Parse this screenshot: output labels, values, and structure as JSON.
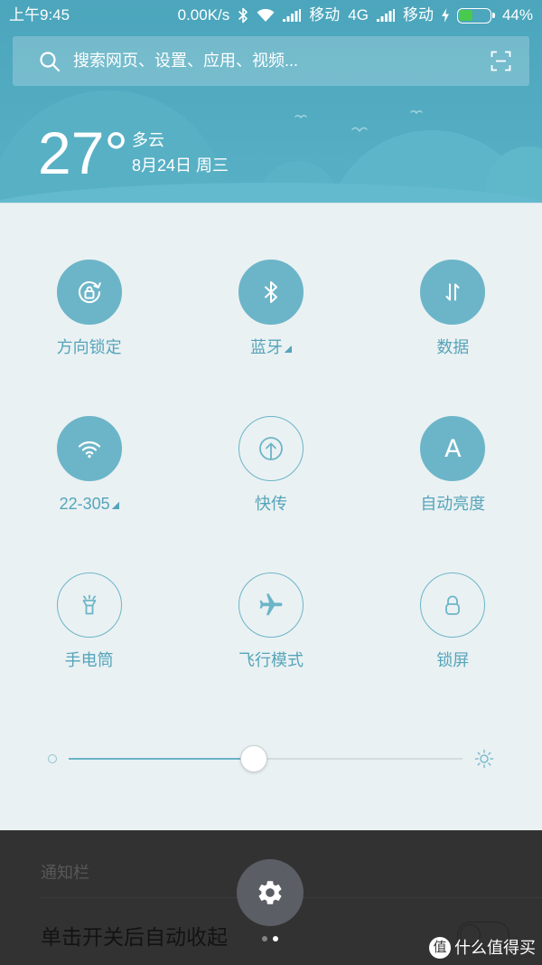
{
  "status_bar": {
    "time": "上午9:45",
    "net_speed": "0.00K/s",
    "carrier_1": "移动",
    "network_type": "4G",
    "carrier_2": "移动",
    "battery": "44%",
    "battery_color": "#49c94d",
    "icons": [
      "bluetooth-icon",
      "wifi-icon",
      "signal-icon",
      "charging-icon",
      "battery-icon"
    ]
  },
  "search": {
    "placeholder": "搜索网页、设置、应用、视频...",
    "icons": [
      "search-icon",
      "scan-icon"
    ]
  },
  "weather": {
    "temperature": "27°",
    "condition": "多云",
    "date": "8月24日 周三"
  },
  "quick_toggles": [
    {
      "label": "方向锁定",
      "icon": "rotation-lock-icon",
      "on": true,
      "expandable": false
    },
    {
      "label": "蓝牙",
      "icon": "bluetooth-icon",
      "on": true,
      "expandable": true
    },
    {
      "label": "数据",
      "icon": "mobile-data-icon",
      "on": true,
      "expandable": false
    },
    {
      "label": "22-305",
      "icon": "wifi-icon",
      "on": true,
      "expandable": true
    },
    {
      "label": "快传",
      "icon": "quick-transfer-icon",
      "on": false,
      "expandable": false
    },
    {
      "label": "自动亮度",
      "icon": "auto-brightness-icon",
      "glyph": "A",
      "on": true,
      "expandable": false
    },
    {
      "label": "手电筒",
      "icon": "flashlight-icon",
      "on": false,
      "expandable": false
    },
    {
      "label": "飞行模式",
      "icon": "airplane-icon",
      "on": false,
      "expandable": false
    },
    {
      "label": "锁屏",
      "icon": "lock-screen-icon",
      "on": false,
      "expandable": false
    }
  ],
  "brightness": {
    "level": 0.47,
    "icons": [
      "brightness-low-icon",
      "brightness-high-icon"
    ]
  },
  "settings_page": {
    "section_header": "通知栏",
    "option_label": "单击开关后自动收起",
    "option_switch_on": false
  },
  "settings_button": {
    "icon": "gear-icon"
  },
  "pager": {
    "count": 2,
    "active_index": 1
  },
  "watermark": {
    "logo_text": "值",
    "text": "什么值得买"
  },
  "colors": {
    "accent": "#6cb5c8",
    "label": "#55a5ba",
    "panel": "#eaf1f3",
    "overlay": "#323232"
  }
}
